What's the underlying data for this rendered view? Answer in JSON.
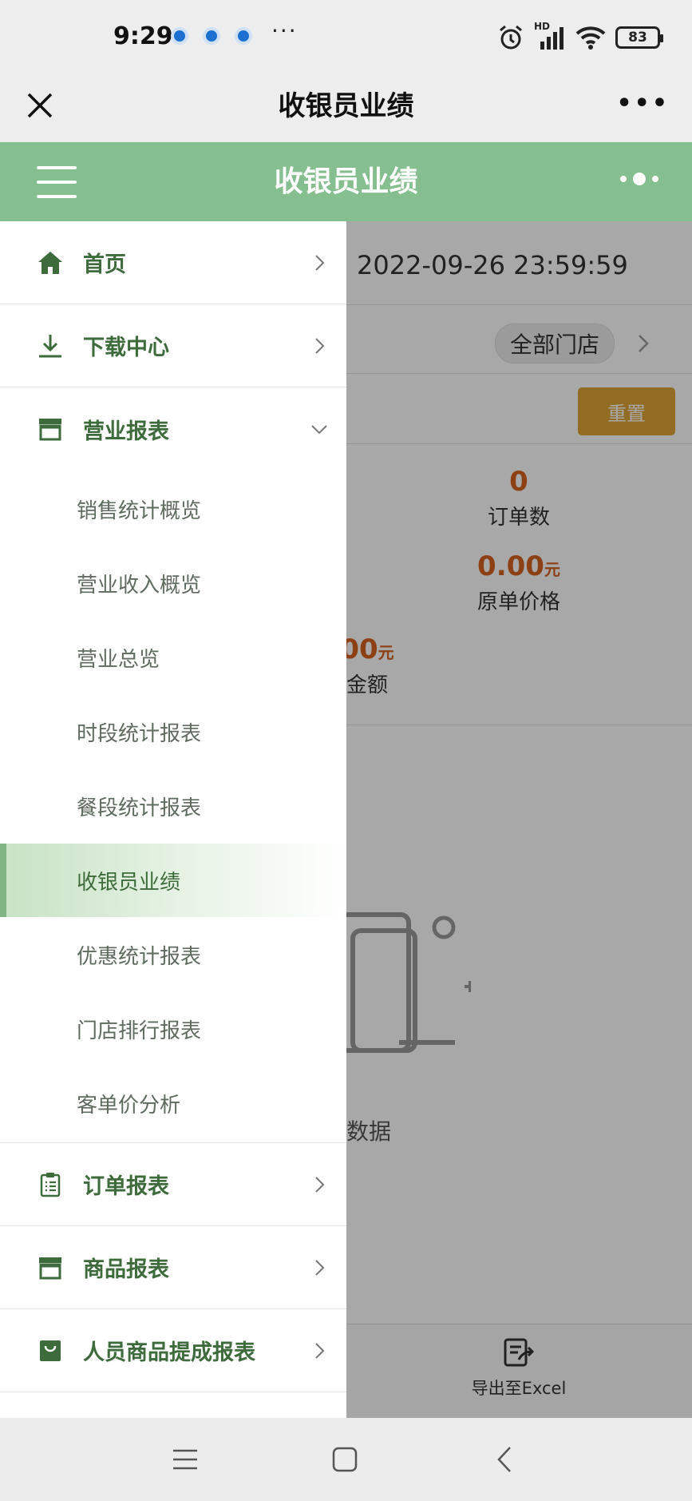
{
  "status_bar": {
    "time": "9:29",
    "more": "···",
    "network": "HD",
    "battery": "83"
  },
  "wechat_nav": {
    "title": "收银员业绩",
    "more": "•••"
  },
  "app_header": {
    "title": "收银员业绩"
  },
  "report": {
    "date_range_end": "~ 2022-09-26 23:59:59",
    "store_filter": "全部门店",
    "reset_label": "重置",
    "stats": [
      {
        "value": "0",
        "unit": "",
        "label": "订单数"
      },
      {
        "value": "0.00",
        "unit": "元",
        "label": "原单价格"
      },
      {
        "value": "00",
        "unit": "元",
        "label": "金额"
      }
    ],
    "empty_text": "数据",
    "export_label": "导出至Excel"
  },
  "drawer": {
    "items_top": [
      {
        "label": "首页",
        "icon": "home-icon"
      },
      {
        "label": "下载中心",
        "icon": "download-icon"
      },
      {
        "label": "营业报表",
        "icon": "store-icon",
        "expanded": true
      }
    ],
    "sub_items": [
      {
        "label": "销售统计概览"
      },
      {
        "label": "营业收入概览"
      },
      {
        "label": "营业总览"
      },
      {
        "label": "时段统计报表"
      },
      {
        "label": "餐段统计报表"
      },
      {
        "label": "收银员业绩",
        "active": true
      },
      {
        "label": "优惠统计报表"
      },
      {
        "label": "门店排行报表"
      },
      {
        "label": "客单价分析"
      }
    ],
    "items_bottom": [
      {
        "label": "订单报表",
        "icon": "clipboard-icon"
      },
      {
        "label": "商品报表",
        "icon": "store-icon"
      },
      {
        "label": "人员商品提成报表",
        "icon": "bag-icon"
      }
    ]
  },
  "colors": {
    "header_green": "#85be8f",
    "menu_text_green": "#3d6b3b",
    "accent_orange": "#e0a536",
    "value_orange": "#d5611e"
  }
}
